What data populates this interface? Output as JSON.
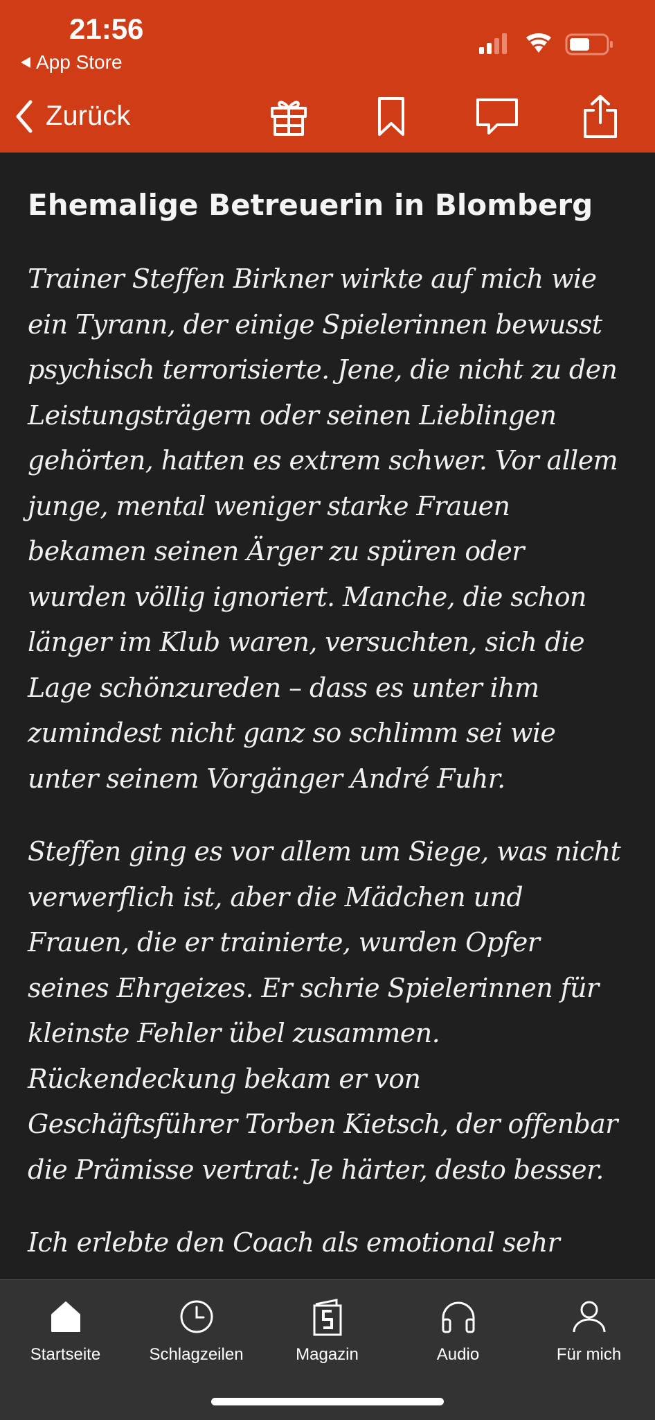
{
  "status_bar": {
    "time": "21:56",
    "back_app": "App Store"
  },
  "toolbar": {
    "back_label": "Zurück",
    "icons": [
      "gift-icon",
      "bookmark-icon",
      "comment-icon",
      "share-icon"
    ]
  },
  "article": {
    "heading": "Ehemalige Betreuerin in Blomberg",
    "paragraphs": [
      "Trainer Steffen Birkner wirkte auf mich wie ein Tyrann, der einige Spielerinnen bewusst psychisch terrorisierte. Jene, die nicht zu den Leistungsträgern oder seinen Lieblingen gehörten, hatten es extrem schwer. Vor allem junge, mental weniger starke Frauen bekamen seinen Ärger zu spüren oder wurden völlig ignoriert. Manche, die schon länger im Klub waren, versuchten, sich die Lage schönzureden – dass es unter ihm zumindest nicht ganz so schlimm sei wie unter seinem Vorgänger André Fuhr.",
      "Steffen ging es vor allem um Siege, was nicht verwerflich ist, aber die Mädchen und Frauen, die er trainierte, wurden Opfer seines Ehrgeizes. Er schrie Spielerinnen für kleinste Fehler übel zusammen. Rückendeckung bekam er von Geschäftsführer Torben Kietsch, der offenbar die Prämisse vertrat: Je härter, desto besser.",
      "Ich erlebte den Coach als emotional sehr"
    ]
  },
  "tabbar": {
    "tabs": [
      {
        "label": "Startseite",
        "icon": "home-icon"
      },
      {
        "label": "Schlagzeilen",
        "icon": "clock-icon"
      },
      {
        "label": "Magazin",
        "icon": "magazine-icon"
      },
      {
        "label": "Audio",
        "icon": "headphones-icon"
      },
      {
        "label": "Für mich",
        "icon": "person-icon"
      }
    ]
  },
  "colors": {
    "header": "#cf3c16",
    "background": "#1f1f1f",
    "tabbar": "#333334",
    "text": "#f0f0f0"
  }
}
